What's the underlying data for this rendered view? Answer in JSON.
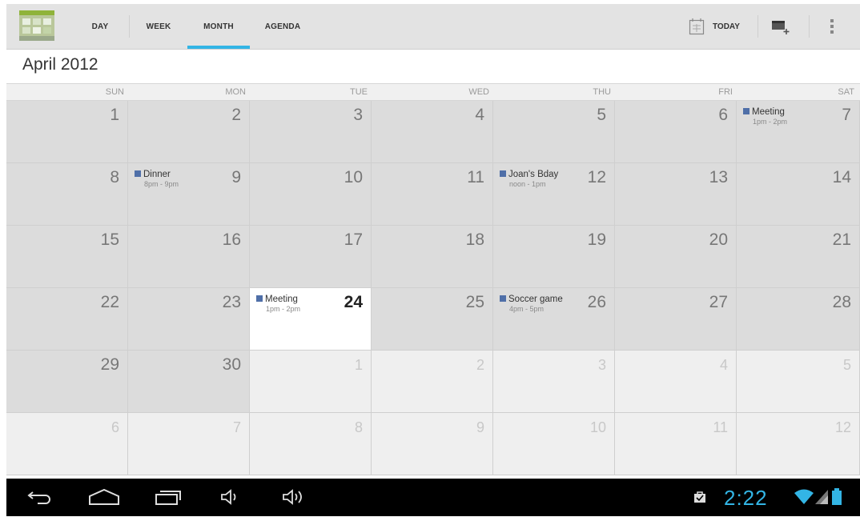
{
  "action_bar": {
    "tabs": [
      {
        "label": "DAY",
        "active": false
      },
      {
        "label": "WEEK",
        "active": false
      },
      {
        "label": "MONTH",
        "active": true
      },
      {
        "label": "AGENDA",
        "active": false
      }
    ],
    "today_label": "TODAY",
    "accent_color": "#33b5e5"
  },
  "month_title": "April 2012",
  "weekdays": [
    "SUN",
    "MON",
    "TUE",
    "WED",
    "THU",
    "FRI",
    "SAT"
  ],
  "weeks": [
    [
      {
        "day": "1",
        "in_month": true
      },
      {
        "day": "2",
        "in_month": true
      },
      {
        "day": "3",
        "in_month": true
      },
      {
        "day": "4",
        "in_month": true
      },
      {
        "day": "5",
        "in_month": true
      },
      {
        "day": "6",
        "in_month": true
      },
      {
        "day": "7",
        "in_month": true,
        "event": {
          "title": "Meeting",
          "time": "1pm - 2pm"
        }
      }
    ],
    [
      {
        "day": "8",
        "in_month": true
      },
      {
        "day": "9",
        "in_month": true,
        "event": {
          "title": "Dinner",
          "time": "8pm - 9pm"
        }
      },
      {
        "day": "10",
        "in_month": true
      },
      {
        "day": "11",
        "in_month": true
      },
      {
        "day": "12",
        "in_month": true,
        "event": {
          "title": "Joan's Bday",
          "time": "noon - 1pm"
        }
      },
      {
        "day": "13",
        "in_month": true
      },
      {
        "day": "14",
        "in_month": true
      }
    ],
    [
      {
        "day": "15",
        "in_month": true
      },
      {
        "day": "16",
        "in_month": true
      },
      {
        "day": "17",
        "in_month": true
      },
      {
        "day": "18",
        "in_month": true
      },
      {
        "day": "19",
        "in_month": true
      },
      {
        "day": "20",
        "in_month": true
      },
      {
        "day": "21",
        "in_month": true
      }
    ],
    [
      {
        "day": "22",
        "in_month": true
      },
      {
        "day": "23",
        "in_month": true
      },
      {
        "day": "24",
        "in_month": true,
        "today": true,
        "event": {
          "title": "Meeting",
          "time": "1pm - 2pm"
        }
      },
      {
        "day": "25",
        "in_month": true
      },
      {
        "day": "26",
        "in_month": true,
        "event": {
          "title": "Soccer game",
          "time": "4pm - 5pm"
        }
      },
      {
        "day": "27",
        "in_month": true
      },
      {
        "day": "28",
        "in_month": true
      }
    ],
    [
      {
        "day": "29",
        "in_month": true
      },
      {
        "day": "30",
        "in_month": true
      },
      {
        "day": "1",
        "in_month": false
      },
      {
        "day": "2",
        "in_month": false
      },
      {
        "day": "3",
        "in_month": false
      },
      {
        "day": "4",
        "in_month": false
      },
      {
        "day": "5",
        "in_month": false
      }
    ],
    [
      {
        "day": "6",
        "in_month": false
      },
      {
        "day": "7",
        "in_month": false
      },
      {
        "day": "8",
        "in_month": false
      },
      {
        "day": "9",
        "in_month": false
      },
      {
        "day": "10",
        "in_month": false
      },
      {
        "day": "11",
        "in_month": false
      },
      {
        "day": "12",
        "in_month": false
      }
    ]
  ],
  "event_color": "#4f6fa8",
  "status_bar": {
    "clock": "2:22"
  },
  "icons": {
    "app": "calendar-app-icon",
    "today": "calendar-today-icon",
    "new_event": "new-event-icon",
    "overflow": "overflow-menu-icon",
    "nav": [
      "back-icon",
      "home-icon",
      "recent-apps-icon",
      "volume-down-icon",
      "volume-up-icon"
    ],
    "status": [
      "notification-icon",
      "wifi-icon",
      "signal-icon",
      "battery-icon"
    ]
  }
}
